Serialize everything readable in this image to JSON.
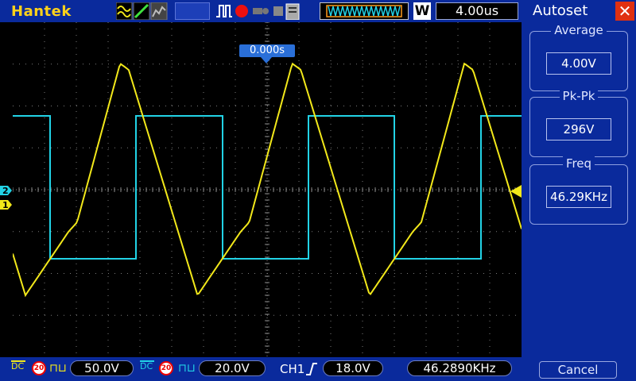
{
  "top_bar": {
    "brand": "Hantek",
    "timebase": "4.00us",
    "acq_mode": "W"
  },
  "trigger_position": "0.000s",
  "channels": [
    {
      "id": "ch1",
      "coupling": "DC",
      "bw_limit": "20",
      "volts_per_div": "50.0V",
      "color": "#f2e81a",
      "marker": "1"
    },
    {
      "id": "ch2",
      "coupling": "DC",
      "bw_limit": "20",
      "volts_per_div": "20.0V",
      "color": "#22d3e6",
      "marker": "2"
    }
  ],
  "trigger": {
    "source": "CH1",
    "level": "18.0V"
  },
  "frequency_readout": "46.2890KHz",
  "side_panel": {
    "title": "Autoset",
    "measurements": [
      {
        "label": "Average",
        "value": "4.00V"
      },
      {
        "label": "Pk-Pk",
        "value": "296V"
      },
      {
        "label": "Freq",
        "value": "46.29KHz"
      }
    ],
    "cancel_label": "Cancel"
  }
}
